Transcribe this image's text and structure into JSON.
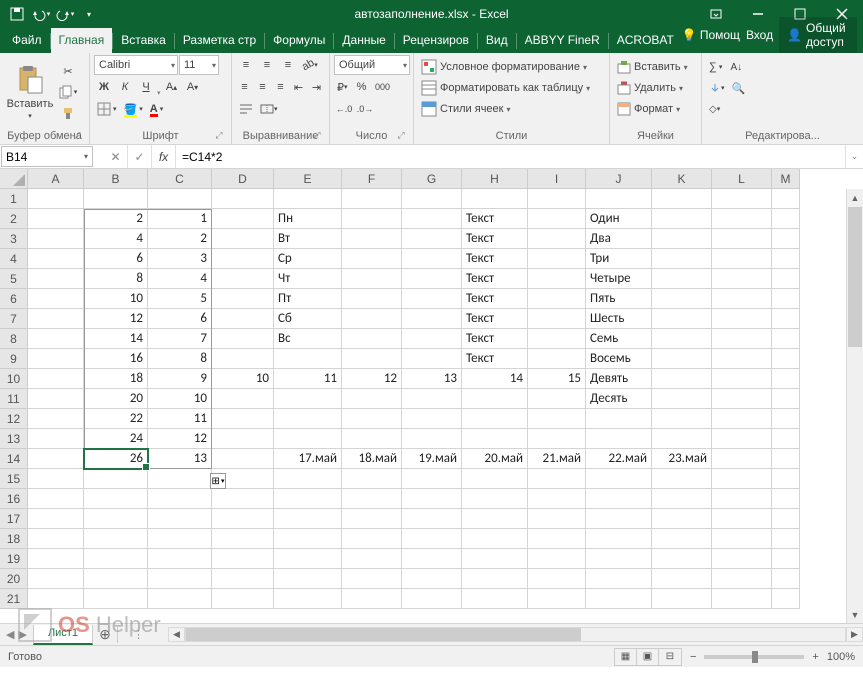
{
  "title": "автозаполнение.xlsx - Excel",
  "qat": {
    "save": "save",
    "undo": "undo",
    "redo": "redo"
  },
  "tabs": [
    "Файл",
    "Главная",
    "Вставка",
    "Разметка стр",
    "Формулы",
    "Данные",
    "Рецензиров",
    "Вид",
    "ABBYY FineR",
    "ACROBAT"
  ],
  "active_tab": 1,
  "help_label": "Помощ",
  "login_label": "Вход",
  "share_label": "Общий доступ",
  "ribbon": {
    "clipboard": {
      "label": "Буфер обмена",
      "paste": "Вставить"
    },
    "font": {
      "label": "Шрифт",
      "name": "Calibri",
      "size": "11",
      "bold": "Ж",
      "italic": "К",
      "underline": "Ч"
    },
    "align": {
      "label": "Выравнивание"
    },
    "number": {
      "label": "Число",
      "format": "Общий"
    },
    "styles": {
      "label": "Стили",
      "cond": "Условное форматирование",
      "table": "Форматировать как таблицу",
      "cell": "Стили ячеек"
    },
    "cells": {
      "label": "Ячейки",
      "insert": "Вставить",
      "delete": "Удалить",
      "format": "Формат"
    },
    "editing": {
      "label": "Редактирова..."
    }
  },
  "namebox": "B14",
  "formula": "=C14*2",
  "columns": [
    "A",
    "B",
    "C",
    "D",
    "E",
    "F",
    "G",
    "H",
    "I",
    "J",
    "K",
    "L",
    "M"
  ],
  "row_count": 21,
  "selected": {
    "row": 14,
    "col": "B"
  },
  "range_bottom_right": {
    "row": 14,
    "col": "C"
  },
  "cells": {
    "B2": "2",
    "B3": "4",
    "B4": "6",
    "B5": "8",
    "B6": "10",
    "B7": "12",
    "B8": "14",
    "B9": "16",
    "B10": "18",
    "B11": "20",
    "B12": "22",
    "B13": "24",
    "B14": "26",
    "C2": "1",
    "C3": "2",
    "C4": "3",
    "C5": "4",
    "C6": "5",
    "C7": "6",
    "C8": "7",
    "C9": "8",
    "C10": "9",
    "C11": "10",
    "C12": "11",
    "C13": "12",
    "C14": "13",
    "D10": "10",
    "E2": "Пн",
    "E3": "Вт",
    "E4": "Ср",
    "E5": "Чт",
    "E6": "Пт",
    "E7": "Сб",
    "E8": "Вс",
    "E10": "11",
    "E14": "17.май",
    "F10": "12",
    "F14": "18.май",
    "G10": "13",
    "G14": "19.май",
    "H2": "Текст",
    "H3": "Текст",
    "H4": "Текст",
    "H5": "Текст",
    "H6": "Текст",
    "H7": "Текст",
    "H8": "Текст",
    "H9": "Текст",
    "H10": "14",
    "H14": "20.май",
    "I10": "15",
    "I14": "21.май",
    "J2": "Один",
    "J3": "Два",
    "J4": "Три",
    "J5": "Четыре",
    "J6": "Пять",
    "J7": "Шесть",
    "J8": "Семь",
    "J9": "Восемь",
    "J10": "Девять",
    "J11": "Десять",
    "J14": "22.май",
    "K14": "23.май"
  },
  "numeric_cols": [
    "B",
    "C",
    "D"
  ],
  "right_align_cells": [
    "E10",
    "E14",
    "F10",
    "F14",
    "G10",
    "G14",
    "H10",
    "H14",
    "I10",
    "I14",
    "J14",
    "K14"
  ],
  "sheet": {
    "name": "Лист1"
  },
  "status": {
    "ready": "Готово",
    "zoom": "100%"
  },
  "watermark": {
    "os": "OS",
    "helper": "Helper"
  }
}
